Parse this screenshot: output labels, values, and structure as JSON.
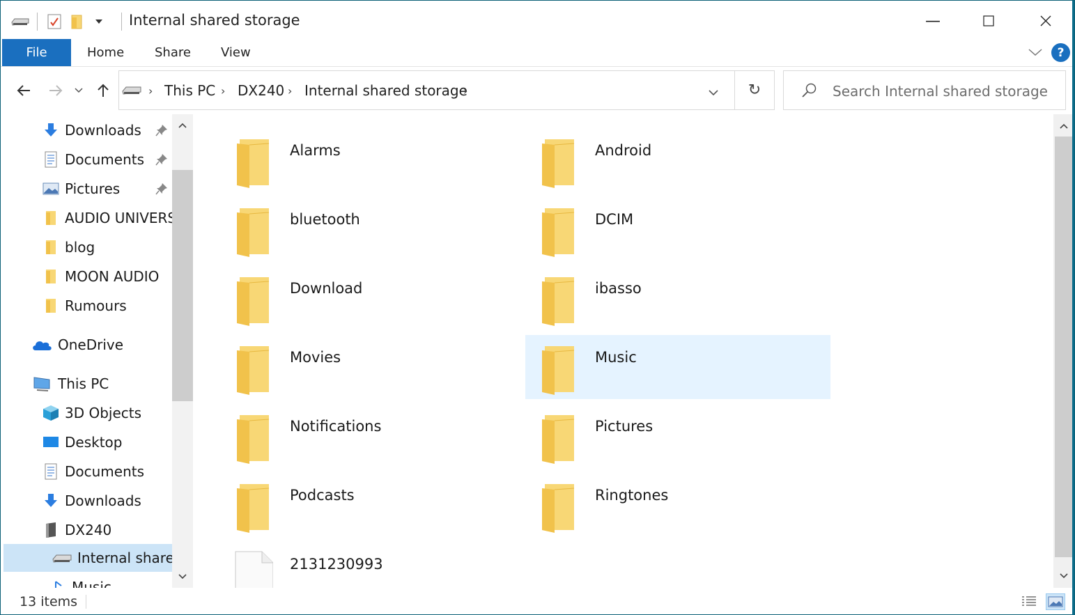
{
  "window": {
    "title": "Internal shared storage",
    "minimize_glyph": "—",
    "maximize_glyph": "☐",
    "close_glyph": "✕"
  },
  "ribbon": {
    "file": "File",
    "tabs": [
      "Home",
      "Share",
      "View"
    ],
    "help": "?"
  },
  "address": {
    "crumbs": [
      "This PC",
      "DX240",
      "Internal shared storage"
    ],
    "refresh_glyph": "↻"
  },
  "search": {
    "placeholder": "Search Internal shared storage"
  },
  "nav": {
    "items": [
      {
        "label": "Downloads",
        "icon": "download-arrow-icon",
        "pinned": true
      },
      {
        "label": "Documents",
        "icon": "document-icon",
        "pinned": true
      },
      {
        "label": "Pictures",
        "icon": "pictures-icon",
        "pinned": true
      },
      {
        "label": "AUDIO UNIVERSE",
        "icon": "folder-icon",
        "pinned": false
      },
      {
        "label": "blog",
        "icon": "folder-icon",
        "pinned": false
      },
      {
        "label": "MOON AUDIO",
        "icon": "folder-icon",
        "pinned": false
      },
      {
        "label": "Rumours",
        "icon": "folder-icon",
        "pinned": false
      },
      {
        "label": "OneDrive",
        "icon": "cloud-icon",
        "pinned": false
      },
      {
        "label": "This PC",
        "icon": "computer-icon",
        "pinned": false
      },
      {
        "label": "3D Objects",
        "icon": "cube-icon",
        "pinned": false
      },
      {
        "label": "Desktop",
        "icon": "desktop-icon",
        "pinned": false
      },
      {
        "label": "Documents",
        "icon": "document-icon",
        "pinned": false
      },
      {
        "label": "Downloads",
        "icon": "download-arrow-icon",
        "pinned": false
      },
      {
        "label": "DX240",
        "icon": "device-icon",
        "pinned": false
      },
      {
        "label": "Internal shared storage",
        "icon": "drive-icon",
        "pinned": false,
        "selected": true
      },
      {
        "label": "Music",
        "icon": "music-icon",
        "pinned": false
      }
    ]
  },
  "files": [
    {
      "name": "Alarms",
      "type": "folder"
    },
    {
      "name": "Android",
      "type": "folder"
    },
    {
      "name": "bluetooth",
      "type": "folder"
    },
    {
      "name": "DCIM",
      "type": "folder"
    },
    {
      "name": "Download",
      "type": "folder"
    },
    {
      "name": "ibasso",
      "type": "folder"
    },
    {
      "name": "Movies",
      "type": "folder"
    },
    {
      "name": "Music",
      "type": "folder",
      "selected": true
    },
    {
      "name": "Notifications",
      "type": "folder"
    },
    {
      "name": "Pictures",
      "type": "folder"
    },
    {
      "name": "Podcasts",
      "type": "folder"
    },
    {
      "name": "Ringtones",
      "type": "folder"
    },
    {
      "name": "2131230993",
      "type": "file"
    }
  ],
  "status": {
    "count": "13 items"
  },
  "colors": {
    "accent": "#1a6fbf",
    "selection": "#e5f3ff",
    "nav_selection": "#cce4f7",
    "folder": "#f8d775"
  }
}
